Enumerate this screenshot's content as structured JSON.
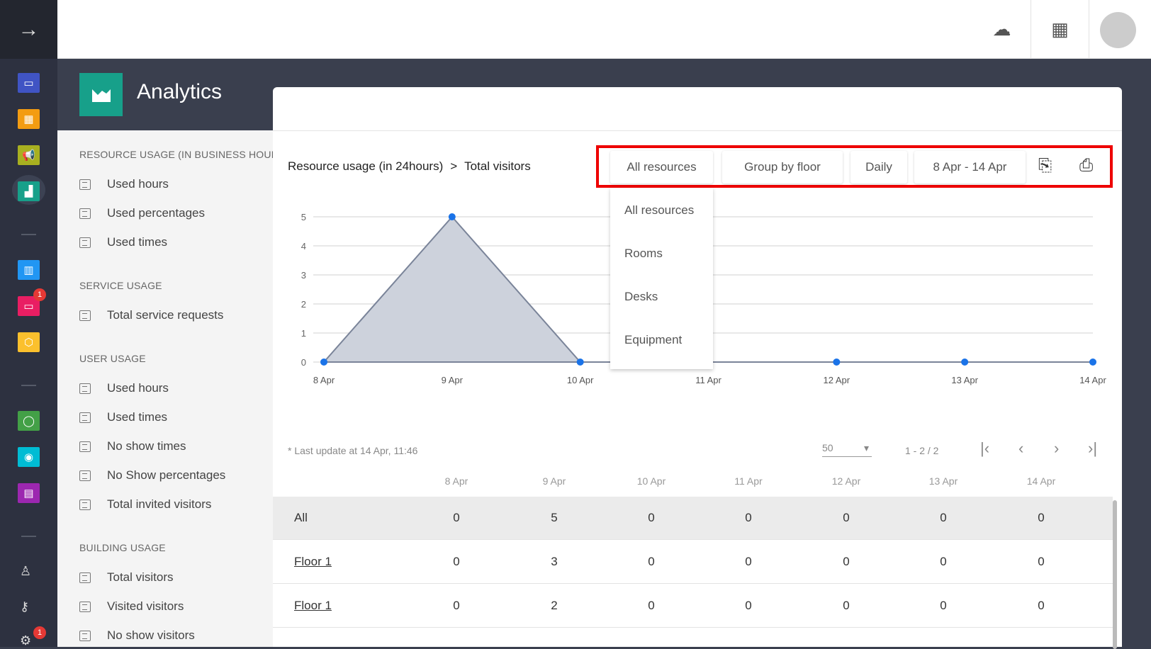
{
  "rail": {
    "badge_monitor": "1",
    "badge_settings": "1"
  },
  "header": {
    "title": "Analytics"
  },
  "sidebar": {
    "sections": [
      {
        "title": "RESOURCE USAGE (IN BUSINESS HOURS)",
        "items": [
          "Used hours",
          "Used percentages",
          "Used times"
        ]
      },
      {
        "title": "SERVICE USAGE",
        "items": [
          "Total service requests"
        ]
      },
      {
        "title": "USER USAGE",
        "items": [
          "Used hours",
          "Used times",
          "No show times",
          "No Show percentages",
          "Total invited visitors"
        ]
      },
      {
        "title": "BUILDING USAGE",
        "items": [
          "Total visitors",
          "Visited visitors",
          "No show visitors"
        ]
      }
    ]
  },
  "main": {
    "breadcrumb": [
      "Resource usage (in 24hours)",
      ">",
      "Total visitors"
    ],
    "toolbar": {
      "resource": "All resources",
      "group": "Group by floor",
      "period": "Daily",
      "range": "8 Apr - 14 Apr"
    },
    "dropdown": [
      "All resources",
      "Rooms",
      "Desks",
      "Equipment"
    ],
    "last_update": "* Last update at 14 Apr, 11:46",
    "page_size": "50",
    "page_info": "1 - 2 / 2"
  },
  "chart_data": {
    "type": "area",
    "categories": [
      "8 Apr",
      "9 Apr",
      "10 Apr",
      "11 Apr",
      "12 Apr",
      "13 Apr",
      "14 Apr"
    ],
    "values": [
      0,
      5,
      0,
      0,
      0,
      0,
      0
    ],
    "ylim": [
      0,
      5
    ],
    "yticks": [
      "0",
      "1",
      "2",
      "3",
      "4",
      "5"
    ],
    "grid": true,
    "title": "",
    "xlabel": "",
    "ylabel": ""
  },
  "table": {
    "columns": [
      "8 Apr",
      "9 Apr",
      "10 Apr",
      "11 Apr",
      "12 Apr",
      "13 Apr",
      "14 Apr"
    ],
    "rows": [
      {
        "label": "All",
        "values": [
          "0",
          "5",
          "0",
          "0",
          "0",
          "0",
          "0"
        ]
      },
      {
        "label": "Floor 1",
        "values": [
          "0",
          "3",
          "0",
          "0",
          "0",
          "0",
          "0"
        ]
      },
      {
        "label": "Floor 1",
        "values": [
          "0",
          "2",
          "0",
          "0",
          "0",
          "0",
          "0"
        ]
      }
    ]
  }
}
